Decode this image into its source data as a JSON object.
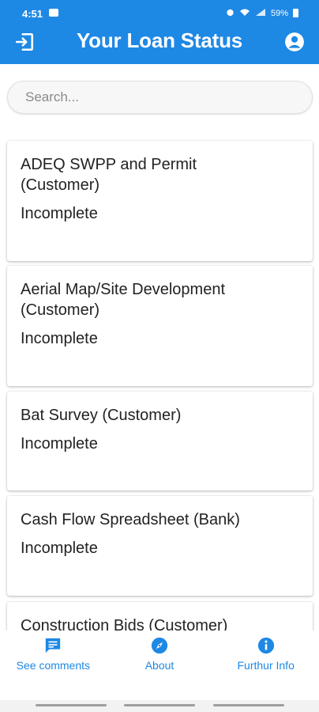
{
  "status_bar": {
    "time": "4:51",
    "battery": "59%"
  },
  "appbar": {
    "title": "Your Loan Status",
    "left_icon": "login-icon",
    "right_icon": "account-circle-icon",
    "color": "#1e88e5"
  },
  "search": {
    "placeholder": "Search..."
  },
  "items": [
    {
      "title_line1": "ADEQ SWPP and Permit",
      "title_line2": "(Customer)",
      "status": "Incomplete"
    },
    {
      "title_line1": "Aerial Map/Site Development",
      "title_line2": "(Customer)",
      "status": "Incomplete"
    },
    {
      "title_line1": "Bat Survey (Customer)",
      "status": "Incomplete"
    },
    {
      "title_line1": "Cash Flow Spreadsheet (Bank)",
      "status": "Incomplete"
    },
    {
      "title_line1": "Construction Bids (Customer)"
    }
  ],
  "bottom_nav": [
    {
      "label": "See comments",
      "icon": "comment-icon"
    },
    {
      "label": "About",
      "icon": "compass-icon"
    },
    {
      "label": "Furthur Info",
      "icon": "info-icon"
    }
  ]
}
